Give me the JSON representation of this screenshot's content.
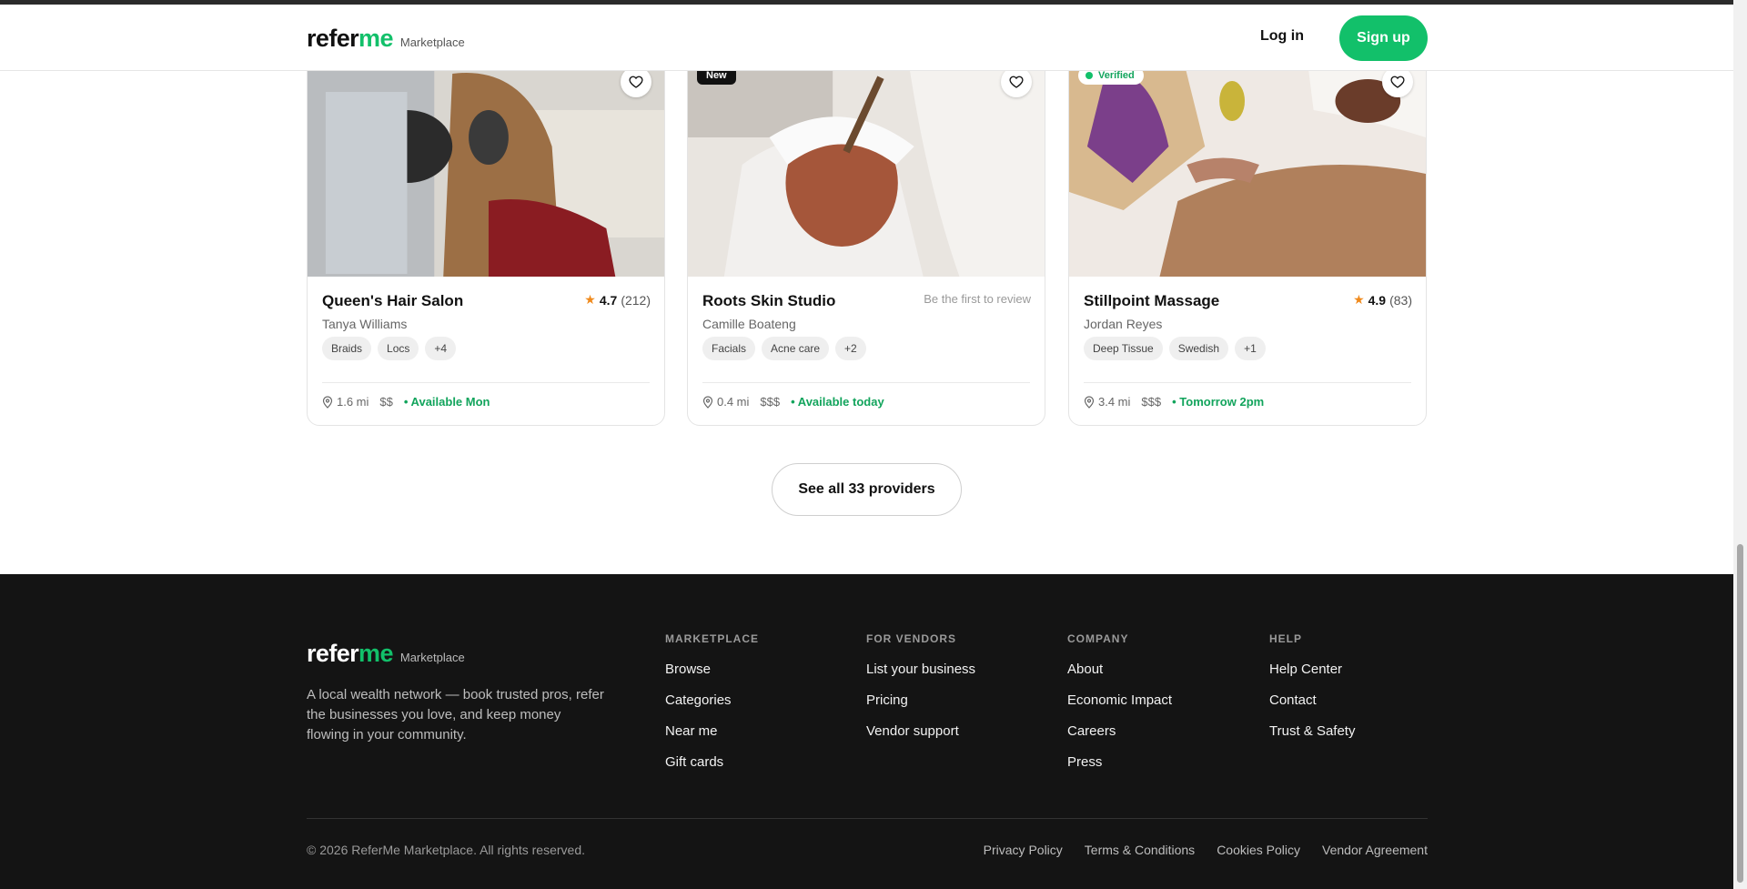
{
  "header": {
    "logo_refer": "refer",
    "logo_me": "me",
    "logo_tag": "Marketplace",
    "login_label": "Log in",
    "signup_label": "Sign up"
  },
  "providers": [
    {
      "name": "Queen's Hair Salon",
      "owner": "Tanya Williams",
      "rating": "4.7",
      "reviews": "(212)",
      "tags": [
        "Braids",
        "Locs",
        "+4"
      ],
      "distance": "1.6 mi",
      "price": "$$",
      "availability": "• Available Mon"
    },
    {
      "name": "Roots Skin Studio",
      "owner": "Camille Boateng",
      "badge": "New",
      "review_prompt": "Be the first to review",
      "tags": [
        "Facials",
        "Acne care",
        "+2"
      ],
      "distance": "0.4 mi",
      "price": "$$$",
      "availability": "• Available today"
    },
    {
      "name": "Stillpoint Massage",
      "owner": "Jordan Reyes",
      "badge": "Verified",
      "rating": "4.9",
      "reviews": "(83)",
      "tags": [
        "Deep Tissue",
        "Swedish",
        "+1"
      ],
      "distance": "3.4 mi",
      "price": "$$$",
      "availability": "• Tomorrow 2pm"
    }
  ],
  "see_all_label": "See all 33 providers",
  "footer": {
    "logo_refer": "refer",
    "logo_me": "me",
    "logo_tag": "Marketplace",
    "description": "A local wealth network — book trusted pros, refer the businesses you love, and keep money flowing in your community.",
    "columns": [
      {
        "heading": "MARKETPLACE",
        "links": [
          "Browse",
          "Categories",
          "Near me",
          "Gift cards"
        ]
      },
      {
        "heading": "FOR VENDORS",
        "links": [
          "List your business",
          "Pricing",
          "Vendor support"
        ]
      },
      {
        "heading": "COMPANY",
        "links": [
          "About",
          "Economic Impact",
          "Careers",
          "Press"
        ]
      },
      {
        "heading": "HELP",
        "links": [
          "Help Center",
          "Contact",
          "Trust & Safety"
        ]
      }
    ],
    "copyright": "© 2026 ReferMe Marketplace. All rights reserved.",
    "legal": [
      "Privacy Policy",
      "Terms & Conditions",
      "Cookies Policy",
      "Vendor Agreement"
    ]
  },
  "colors": {
    "brand_green": "#12c06a",
    "star_orange": "#f08a1c",
    "footer_bg": "#141414"
  }
}
